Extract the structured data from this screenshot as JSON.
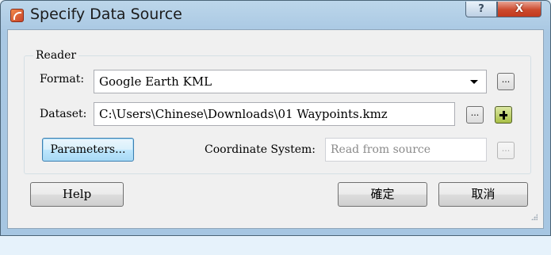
{
  "window": {
    "title": "Specify Data Source",
    "help_glyph": "?",
    "close_glyph": "X"
  },
  "reader": {
    "group_label": "Reader",
    "format_label": "Format:",
    "format_value": "Google Earth KML",
    "dataset_label": "Dataset:",
    "dataset_value": "C:\\Users\\Chinese\\Downloads\\01 Waypoints.kmz",
    "browse_label": "...",
    "parameters_label": "Parameters...",
    "coord_label": "Coordinate System:",
    "coord_value": "Read from source"
  },
  "buttons": {
    "help": "Help",
    "ok": "確定",
    "cancel": "取消"
  }
}
